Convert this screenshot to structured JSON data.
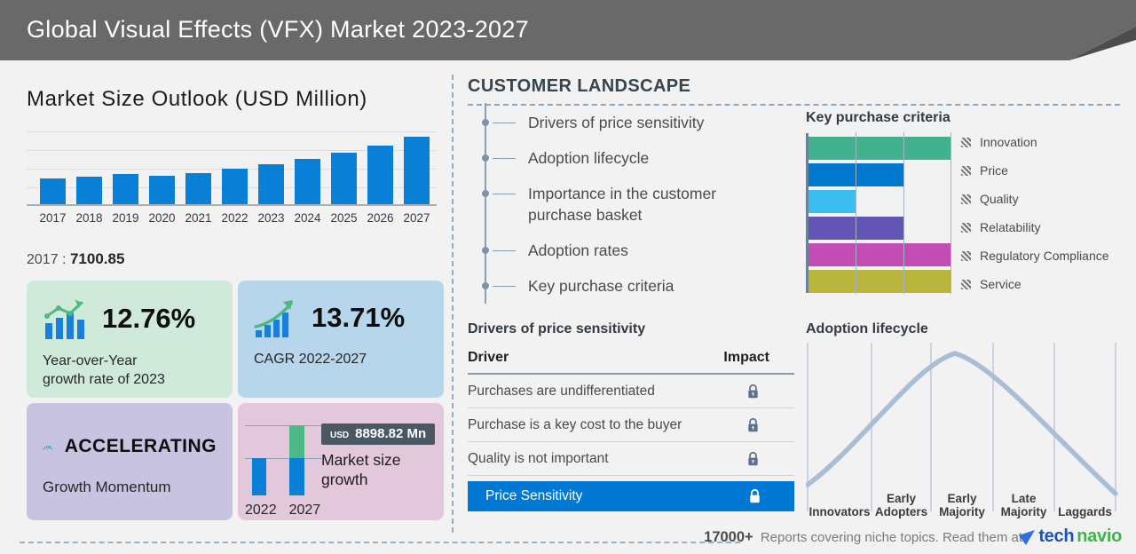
{
  "header": {
    "title": "Global Visual Effects (VFX) Market 2023-2027"
  },
  "left": {
    "title": "Market Size Outlook (USD Million)",
    "callout": {
      "year": "2017",
      "sep": ":",
      "value": "7100.85"
    }
  },
  "stats": {
    "yoy": {
      "value": "12.76%",
      "line1": "Year-over-Year",
      "line2": "growth rate of 2023",
      "icon": "bar-trend-icon",
      "bg": "#cfe9da"
    },
    "cagr": {
      "value": "13.71%",
      "label": "CAGR 2022-2027",
      "icon": "growth-arrow-icon",
      "bg": "#b7d5eb"
    },
    "momentum": {
      "value": "ACCELERATING",
      "label": "Growth Momentum",
      "icon": "speedometer-icon",
      "bg": "#c8c3e1"
    },
    "growth": {
      "badge_currency": "USD",
      "badge_value": "8898.82 Mn",
      "label": "Market size growth",
      "bg": "#e3c7da"
    }
  },
  "customer_landscape": {
    "title": "CUSTOMER LANDSCAPE",
    "items": [
      "Drivers of price sensitivity",
      "Adoption lifecycle",
      "Importance in the customer purchase basket",
      "Adoption rates",
      "Key purchase criteria"
    ]
  },
  "price_sensitivity": {
    "title": "Drivers of price sensitivity",
    "columns": [
      "Driver",
      "Impact"
    ],
    "rows": [
      "Purchases are undifferentiated",
      "Purchase is a key cost to the buyer",
      "Quality is not important"
    ],
    "highlight_row": "Price Sensitivity",
    "highlight_color": "#0078d4",
    "impact_icon": "lock-icon"
  },
  "footer": {
    "stat": "17000+",
    "text": "Reports covering niche topics. Read them at",
    "brand": {
      "icon": "technavio-arrow-icon",
      "part1": "tech",
      "part2": "navio",
      "part1_color": "#1d50b8",
      "part2_color": "#3fb549"
    }
  },
  "colors": {
    "header_bg": "#696969",
    "bar_blue": "#0a7fd6",
    "growth_green": "#4cb987",
    "highlight_blue": "#0078d4",
    "curve_slate": "#a9bdd6"
  },
  "chart_data": [
    {
      "id": "market_size_outlook",
      "type": "bar",
      "title": "Market Size Outlook (USD Million)",
      "categories": [
        "2017",
        "2018",
        "2019",
        "2020",
        "2021",
        "2022",
        "2023",
        "2024",
        "2025",
        "2026",
        "2027"
      ],
      "values": [
        7100.85,
        7670,
        8400,
        7840,
        8730,
        9868.72,
        11128,
        12450,
        14200,
        16300,
        18767.54
      ],
      "labeled_point": {
        "category": "2017",
        "value": 7100.85
      },
      "xlabel": "",
      "ylabel": "USD Million",
      "ylim": [
        0,
        20700
      ],
      "grid": true,
      "bar_color": "#0a7fd6"
    },
    {
      "id": "key_purchase_criteria",
      "type": "bar",
      "orientation": "horizontal",
      "title": "Key purchase criteria",
      "categories": [
        "Innovation",
        "Price",
        "Quality",
        "Relatability",
        "Regulatory Compliance",
        "Service"
      ],
      "values": [
        3,
        2,
        1,
        2,
        3,
        3
      ],
      "colors": [
        "#42b18e",
        "#0078d0",
        "#3cbdf0",
        "#6355b3",
        "#c44cb5",
        "#bab63c"
      ],
      "xlim": [
        0,
        3
      ],
      "grid": true,
      "legend_position": "right"
    },
    {
      "id": "adoption_lifecycle",
      "type": "area",
      "title": "Adoption lifecycle",
      "curve": "bell",
      "stages": [
        "Innovators",
        "Early Adopters",
        "Early Majority",
        "Late Majority",
        "Laggards"
      ],
      "peak_stage": "Early Majority",
      "line_color": "#a9bdd6"
    },
    {
      "id": "market_size_growth",
      "type": "bar",
      "title": "Market size growth",
      "categories": [
        "2022",
        "2027"
      ],
      "values": [
        9868.72,
        18767.54
      ],
      "growth": 8898.82,
      "growth_label": "USD 8898.82 Mn",
      "colors": {
        "base": "#0a7fd6",
        "growth": "#4cb987"
      }
    }
  ]
}
